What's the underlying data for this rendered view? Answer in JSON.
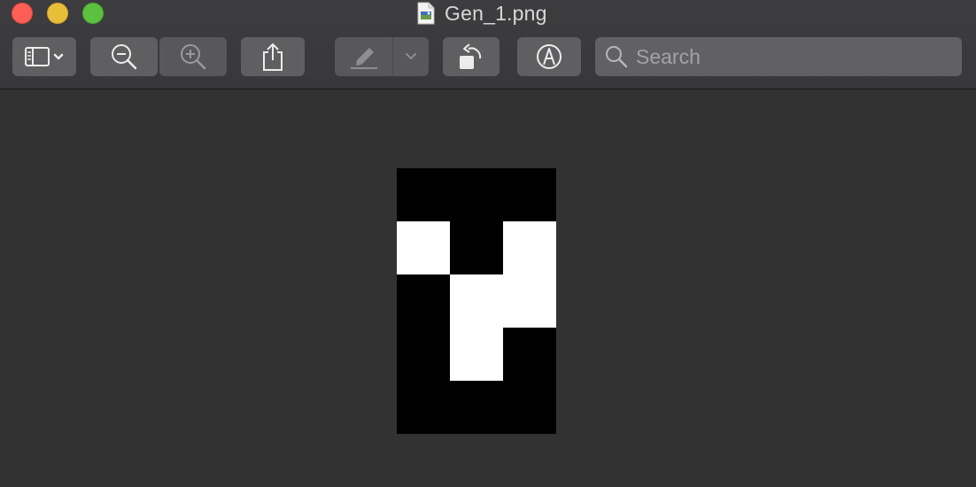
{
  "window": {
    "title": "Gen_1.png"
  },
  "toolbar": {
    "sidebar_icon": "sidebar-icon",
    "zoom_out_icon": "zoom-out-icon",
    "zoom_in_icon": "zoom-in-icon",
    "share_icon": "share-icon",
    "markup_icon": "highlighter-icon",
    "rotate_icon": "rotate-left-icon",
    "annotate_icon": "markup-icon"
  },
  "search": {
    "placeholder": "Search",
    "value": ""
  },
  "image": {
    "rows": 5,
    "cols": 3,
    "pixels": [
      [
        0,
        0,
        0
      ],
      [
        1,
        0,
        1
      ],
      [
        0,
        1,
        1
      ],
      [
        0,
        1,
        0
      ],
      [
        0,
        0,
        0
      ]
    ]
  },
  "colors": {
    "close": "#fd5f57",
    "minimize": "#e6be3a",
    "zoom": "#5cc13f",
    "background": "#323232"
  }
}
